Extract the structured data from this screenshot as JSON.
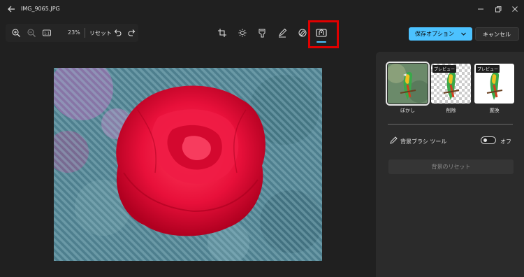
{
  "window": {
    "title": "IMG_9065.JPG"
  },
  "toolbar": {
    "zoom": "23%",
    "reset": "リセット"
  },
  "actions": {
    "save": "保存オプション",
    "cancel": "キャンセル"
  },
  "panel": {
    "options": [
      {
        "label": "ぼかし",
        "badge": ""
      },
      {
        "label": "削除",
        "badge": "プレビュー"
      },
      {
        "label": "置換",
        "badge": "プレビュー"
      }
    ],
    "selected_option": "ぼかし",
    "brush_tool_label": "背景ブラシ ツール",
    "toggle_state": "オフ",
    "reset_background": "背景のリセット"
  },
  "colors": {
    "accent": "#4cc2ff",
    "highlight": "#e00000",
    "rose": "#e8103a",
    "overlay": "#6aa6b5"
  }
}
